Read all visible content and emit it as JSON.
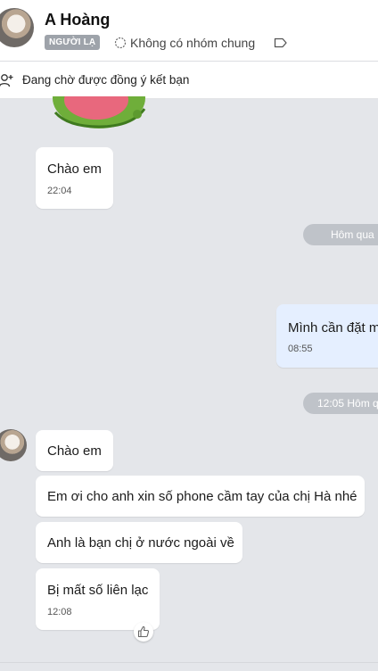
{
  "header": {
    "name": "A Hoàng",
    "badge": "NGƯỜI LẠ",
    "groups": "Không có nhóm chung",
    "icons": {
      "avatar": "avatar",
      "groups": "groups-icon",
      "tag": "tag-icon"
    }
  },
  "pending": {
    "text": "Đang chờ được đồng ý kết bạn",
    "icon": "add-friend-icon"
  },
  "messages": [
    {
      "direction": "incoming",
      "text": "Chào em",
      "time": "22:04"
    },
    {
      "direction": "outgoing",
      "text": "Mình cần đặt m",
      "time": "08:55"
    },
    {
      "direction": "incoming",
      "text": "Chào em"
    },
    {
      "direction": "incoming",
      "text": "Em ơi cho anh xin số phone cầm tay của chị Hà nhé"
    },
    {
      "direction": "incoming",
      "text": "Anh là bạn chị ở nước ngoài về"
    },
    {
      "direction": "incoming",
      "text": "Bị mất số liên lạc",
      "time": "12:08"
    }
  ],
  "separators": [
    {
      "text": "Hôm qua"
    },
    {
      "text": "12:05 Hôm q"
    }
  ],
  "colors": {
    "background": "#e4e6ea",
    "incoming_bubble": "#ffffff",
    "outgoing_bubble": "#e5efff",
    "badge": "#9ea3aa",
    "separator": "#bfc3c9"
  }
}
